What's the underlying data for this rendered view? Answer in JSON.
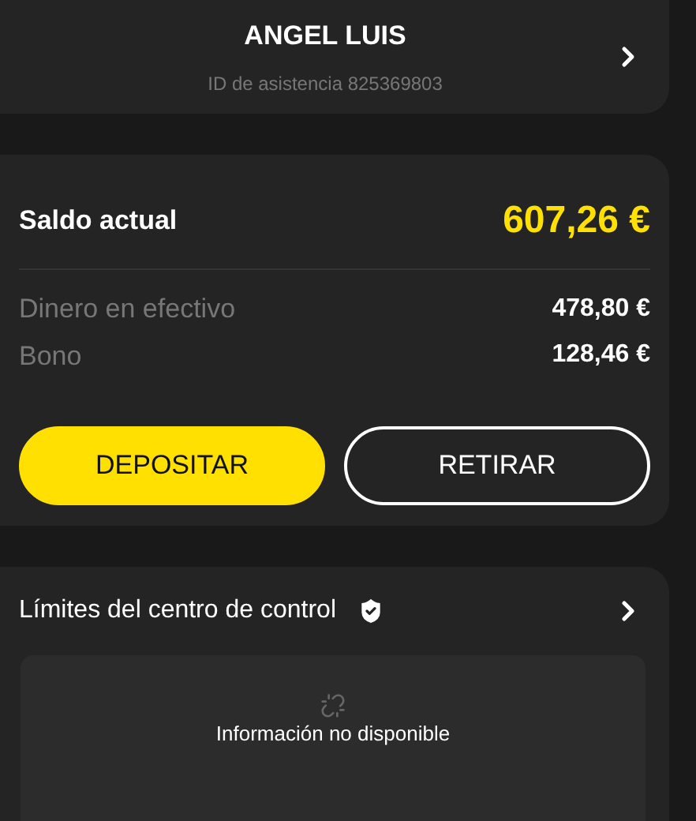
{
  "profile": {
    "name": "ANGEL LUIS",
    "assistance_id": "ID de asistencia 825369803"
  },
  "balance": {
    "label": "Saldo actual",
    "amount": "607,26 €",
    "rows": [
      {
        "label": "Dinero en efectivo",
        "value": "478,80 €"
      },
      {
        "label": "Bono",
        "value": "128,46 €"
      }
    ],
    "buttons": [
      {
        "label": "DEPOSITAR",
        "kind": "primary"
      },
      {
        "label": "RETIRAR",
        "kind": "outline"
      }
    ]
  },
  "limits": {
    "title": "Límites del centro de control",
    "message": "Información no disponible"
  }
}
